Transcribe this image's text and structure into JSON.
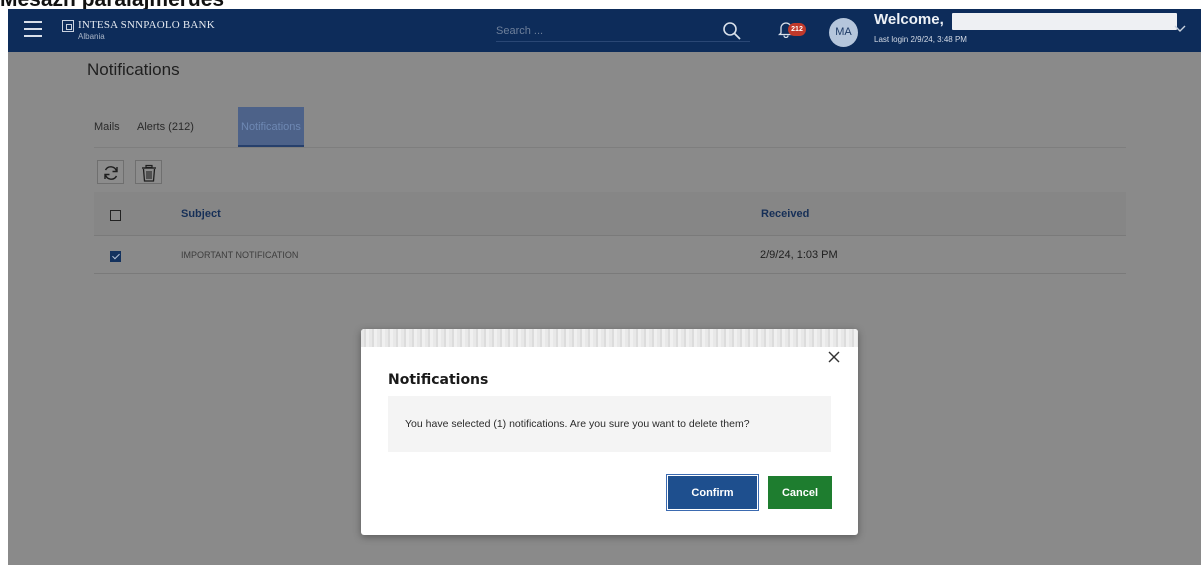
{
  "page_caption": "Mesazh paralajmërues",
  "navbar": {
    "logo_name": "INTESA SNNPAOLO BANK",
    "logo_sub": "Albania",
    "search_placeholder": "Search ...",
    "notification_count": "212",
    "avatar_initials": "MA",
    "welcome_label": "Welcome,",
    "last_login": "Last login 2/9/24, 3:48 PM"
  },
  "page": {
    "title": "Notifications",
    "tabs": [
      {
        "label": "Mails"
      },
      {
        "label": "Alerts (212)"
      },
      {
        "label": "Notifications"
      }
    ],
    "active_tab": "Notifications"
  },
  "table": {
    "columns": [
      "Subject",
      "Received"
    ],
    "rows": [
      {
        "subject": "IMPORTANT NOTIFICATION",
        "received": "2/9/24, 1:03 PM",
        "checked": true
      }
    ]
  },
  "modal": {
    "title": "Notifications",
    "message": "You have selected (1) notifications. Are you sure you want to delete them?",
    "confirm_label": "Confirm",
    "cancel_label": "Cancel"
  },
  "colors": {
    "navbar": "#0d2c5a",
    "overlay": "#8a8a8a",
    "confirm": "#1e4f8e",
    "cancel": "#1e7d2f",
    "badge": "#c0392b"
  }
}
